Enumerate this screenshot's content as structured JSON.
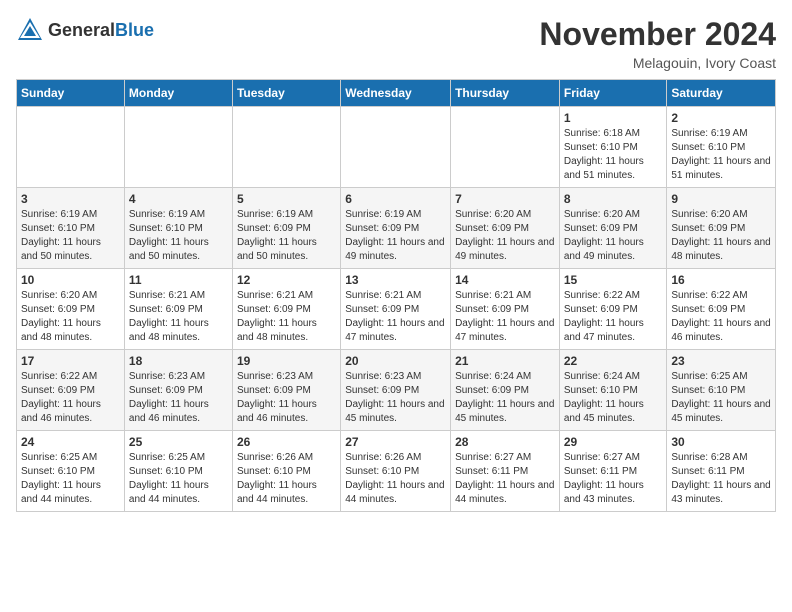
{
  "header": {
    "logo_general": "General",
    "logo_blue": "Blue",
    "title": "November 2024",
    "subtitle": "Melagouin, Ivory Coast"
  },
  "days_of_week": [
    "Sunday",
    "Monday",
    "Tuesday",
    "Wednesday",
    "Thursday",
    "Friday",
    "Saturday"
  ],
  "weeks": [
    {
      "days": [
        {
          "num": "",
          "info": ""
        },
        {
          "num": "",
          "info": ""
        },
        {
          "num": "",
          "info": ""
        },
        {
          "num": "",
          "info": ""
        },
        {
          "num": "",
          "info": ""
        },
        {
          "num": "1",
          "info": "Sunrise: 6:18 AM\nSunset: 6:10 PM\nDaylight: 11 hours and 51 minutes."
        },
        {
          "num": "2",
          "info": "Sunrise: 6:19 AM\nSunset: 6:10 PM\nDaylight: 11 hours and 51 minutes."
        }
      ]
    },
    {
      "days": [
        {
          "num": "3",
          "info": "Sunrise: 6:19 AM\nSunset: 6:10 PM\nDaylight: 11 hours and 50 minutes."
        },
        {
          "num": "4",
          "info": "Sunrise: 6:19 AM\nSunset: 6:10 PM\nDaylight: 11 hours and 50 minutes."
        },
        {
          "num": "5",
          "info": "Sunrise: 6:19 AM\nSunset: 6:09 PM\nDaylight: 11 hours and 50 minutes."
        },
        {
          "num": "6",
          "info": "Sunrise: 6:19 AM\nSunset: 6:09 PM\nDaylight: 11 hours and 49 minutes."
        },
        {
          "num": "7",
          "info": "Sunrise: 6:20 AM\nSunset: 6:09 PM\nDaylight: 11 hours and 49 minutes."
        },
        {
          "num": "8",
          "info": "Sunrise: 6:20 AM\nSunset: 6:09 PM\nDaylight: 11 hours and 49 minutes."
        },
        {
          "num": "9",
          "info": "Sunrise: 6:20 AM\nSunset: 6:09 PM\nDaylight: 11 hours and 48 minutes."
        }
      ]
    },
    {
      "days": [
        {
          "num": "10",
          "info": "Sunrise: 6:20 AM\nSunset: 6:09 PM\nDaylight: 11 hours and 48 minutes."
        },
        {
          "num": "11",
          "info": "Sunrise: 6:21 AM\nSunset: 6:09 PM\nDaylight: 11 hours and 48 minutes."
        },
        {
          "num": "12",
          "info": "Sunrise: 6:21 AM\nSunset: 6:09 PM\nDaylight: 11 hours and 48 minutes."
        },
        {
          "num": "13",
          "info": "Sunrise: 6:21 AM\nSunset: 6:09 PM\nDaylight: 11 hours and 47 minutes."
        },
        {
          "num": "14",
          "info": "Sunrise: 6:21 AM\nSunset: 6:09 PM\nDaylight: 11 hours and 47 minutes."
        },
        {
          "num": "15",
          "info": "Sunrise: 6:22 AM\nSunset: 6:09 PM\nDaylight: 11 hours and 47 minutes."
        },
        {
          "num": "16",
          "info": "Sunrise: 6:22 AM\nSunset: 6:09 PM\nDaylight: 11 hours and 46 minutes."
        }
      ]
    },
    {
      "days": [
        {
          "num": "17",
          "info": "Sunrise: 6:22 AM\nSunset: 6:09 PM\nDaylight: 11 hours and 46 minutes."
        },
        {
          "num": "18",
          "info": "Sunrise: 6:23 AM\nSunset: 6:09 PM\nDaylight: 11 hours and 46 minutes."
        },
        {
          "num": "19",
          "info": "Sunrise: 6:23 AM\nSunset: 6:09 PM\nDaylight: 11 hours and 46 minutes."
        },
        {
          "num": "20",
          "info": "Sunrise: 6:23 AM\nSunset: 6:09 PM\nDaylight: 11 hours and 45 minutes."
        },
        {
          "num": "21",
          "info": "Sunrise: 6:24 AM\nSunset: 6:09 PM\nDaylight: 11 hours and 45 minutes."
        },
        {
          "num": "22",
          "info": "Sunrise: 6:24 AM\nSunset: 6:10 PM\nDaylight: 11 hours and 45 minutes."
        },
        {
          "num": "23",
          "info": "Sunrise: 6:25 AM\nSunset: 6:10 PM\nDaylight: 11 hours and 45 minutes."
        }
      ]
    },
    {
      "days": [
        {
          "num": "24",
          "info": "Sunrise: 6:25 AM\nSunset: 6:10 PM\nDaylight: 11 hours and 44 minutes."
        },
        {
          "num": "25",
          "info": "Sunrise: 6:25 AM\nSunset: 6:10 PM\nDaylight: 11 hours and 44 minutes."
        },
        {
          "num": "26",
          "info": "Sunrise: 6:26 AM\nSunset: 6:10 PM\nDaylight: 11 hours and 44 minutes."
        },
        {
          "num": "27",
          "info": "Sunrise: 6:26 AM\nSunset: 6:10 PM\nDaylight: 11 hours and 44 minutes."
        },
        {
          "num": "28",
          "info": "Sunrise: 6:27 AM\nSunset: 6:11 PM\nDaylight: 11 hours and 44 minutes."
        },
        {
          "num": "29",
          "info": "Sunrise: 6:27 AM\nSunset: 6:11 PM\nDaylight: 11 hours and 43 minutes."
        },
        {
          "num": "30",
          "info": "Sunrise: 6:28 AM\nSunset: 6:11 PM\nDaylight: 11 hours and 43 minutes."
        }
      ]
    }
  ]
}
